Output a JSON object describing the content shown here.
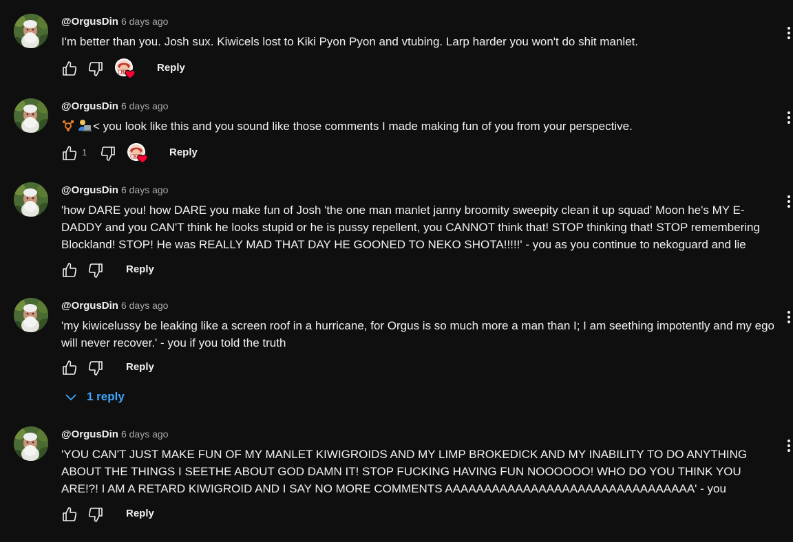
{
  "comments": [
    {
      "author": "@OrgusDin",
      "time": "6 days ago",
      "text": "I'm better than you. Josh sux. Kiwicels lost to Kiki Pyon Pyon and vtubing. Larp harder you won't do shit manlet.",
      "likes": "",
      "creator_heart": true,
      "reply_label": "Reply"
    },
    {
      "author": "@OrgusDin",
      "time": "6 days ago",
      "text": "< you look like this and you sound like those comments I made making fun of you from your perspective.",
      "likes": "1",
      "creator_heart": true,
      "reply_label": "Reply"
    },
    {
      "author": "@OrgusDin",
      "time": "6 days ago",
      "text": "'how DARE you! how DARE you make fun of Josh 'the one man manlet janny broomity sweepity clean it up squad' Moon he's MY E-DADDY and you CAN'T think he looks stupid or he is pussy repellent, you CANNOT think that! STOP thinking that! STOP remembering Blockland! STOP! He was REALLY MAD THAT DAY HE GOONED TO NEKO SHOTA!!!!!' - you as you continue to nekoguard and lie",
      "likes": "",
      "creator_heart": false,
      "reply_label": "Reply"
    },
    {
      "author": "@OrgusDin",
      "time": "6 days ago",
      "text": "'my kiwicelussy be leaking like a screen roof in a hurricane, for Orgus is so much more a man than I; I am seething impotently and my ego will never recover.' - you if you told the truth",
      "likes": "",
      "creator_heart": false,
      "reply_label": "Reply",
      "replies_label": "1 reply"
    },
    {
      "author": "@OrgusDin",
      "time": "6 days ago",
      "text": "'YOU CAN'T JUST MAKE FUN OF MY MANLET KIWIGROIDS AND MY LIMP BROKEDICK AND MY INABILITY TO DO ANYTHING ABOUT THE THINGS I SEETHE ABOUT GOD DAMN IT! STOP FUCKING HAVING FUN NOOOOOO! WHO DO YOU THINK YOU ARE!?! I AM A RETARD KIWIGROID AND I SAY NO MORE COMMENTS AAAAAAAAAAAAAAAAAAAAAAAAAAAAAAAA' - you",
      "likes": "",
      "creator_heart": false,
      "reply_label": "Reply"
    }
  ],
  "colors": {
    "background": "#0f0f0f",
    "text": "#f1f1f1",
    "secondary_text": "#aaaaaa",
    "link": "#3ea6ff",
    "heart": "#ff0033"
  },
  "icons": [
    "like-icon",
    "dislike-icon",
    "creator-heart-icon",
    "more-actions-icon",
    "chevron-down-icon",
    "emoji-transgender-symbol",
    "emoji-technologist"
  ]
}
